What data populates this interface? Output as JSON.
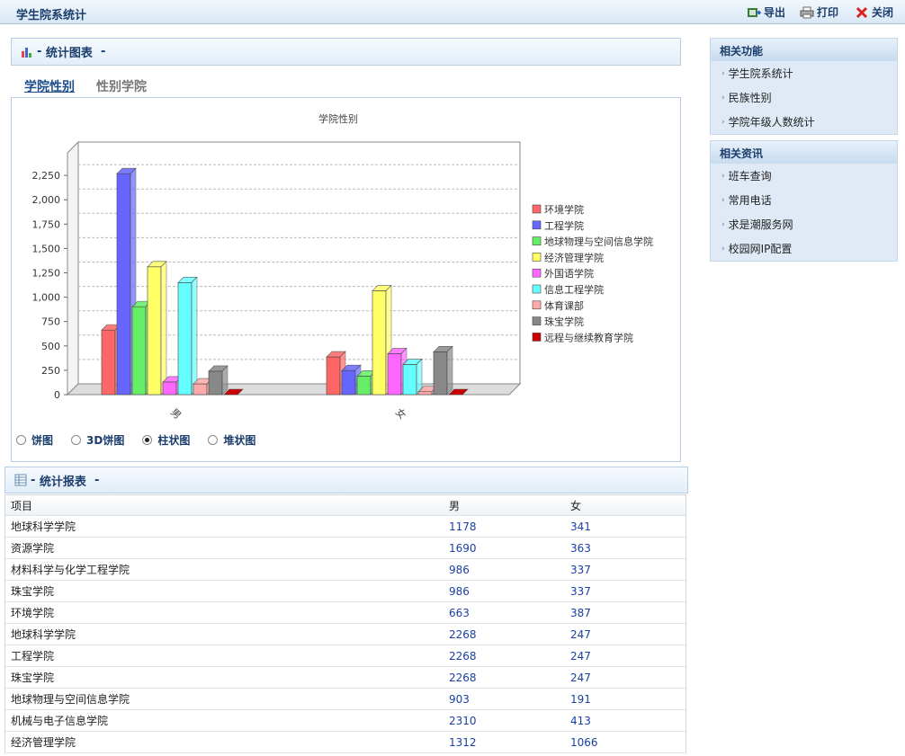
{
  "window": {
    "title": "学生院系统计",
    "export_label": "导出",
    "print_label": "打印",
    "close_label": "关闭"
  },
  "chart_section": {
    "title": "统计图表",
    "tabs": [
      "学院性别",
      "性别学院"
    ],
    "chart_types": [
      "饼图",
      "3D饼图",
      "柱状图",
      "堆状图"
    ],
    "selected_type": "柱状图"
  },
  "chart_data": {
    "type": "bar",
    "title": "学院性别",
    "categories": [
      "男",
      "女"
    ],
    "ylim": [
      0,
      2500
    ],
    "yticks": [
      "0",
      "250",
      "500",
      "750",
      "1,000",
      "1,250",
      "1,500",
      "1,750",
      "2,000",
      "2,250"
    ],
    "series": [
      {
        "name": "环境学院",
        "color": "#ff6666",
        "values": [
          663,
          387
        ]
      },
      {
        "name": "工程学院",
        "color": "#6666ff",
        "values": [
          2268,
          247
        ]
      },
      {
        "name": "地球物理与空间信息学院",
        "color": "#66ee66",
        "values": [
          903,
          191
        ]
      },
      {
        "name": "经济管理学院",
        "color": "#ffff66",
        "values": [
          1312,
          1066
        ]
      },
      {
        "name": "外国语学院",
        "color": "#ff66ff",
        "values": [
          130,
          420
        ]
      },
      {
        "name": "信息工程学院",
        "color": "#66ffff",
        "values": [
          1150,
          310
        ]
      },
      {
        "name": "体育课部",
        "color": "#ffaaaa",
        "values": [
          110,
          30
        ]
      },
      {
        "name": "珠宝学院",
        "color": "#888888",
        "values": [
          240,
          440
        ]
      },
      {
        "name": "远程与继续教育学院",
        "color": "#cc0000",
        "values": [
          0,
          0
        ]
      }
    ]
  },
  "report": {
    "title": "统计报表",
    "headers": [
      "项目",
      "男",
      "女"
    ],
    "rows": [
      [
        "地球科学学院",
        "1178",
        "341"
      ],
      [
        "资源学院",
        "1690",
        "363"
      ],
      [
        "材料科学与化学工程学院",
        "986",
        "337"
      ],
      [
        "珠宝学院",
        "986",
        "337"
      ],
      [
        "环境学院",
        "663",
        "387"
      ],
      [
        "地球科学学院",
        "2268",
        "247"
      ],
      [
        "工程学院",
        "2268",
        "247"
      ],
      [
        "珠宝学院",
        "2268",
        "247"
      ],
      [
        "地球物理与空间信息学院",
        "903",
        "191"
      ],
      [
        "机械与电子信息学院",
        "2310",
        "413"
      ],
      [
        "经济管理学院",
        "1312",
        "1066"
      ]
    ]
  },
  "sidebar": {
    "related_functions": {
      "title": "相关功能",
      "items": [
        "学生院系统计",
        "民族性别",
        "学院年级人数统计"
      ]
    },
    "related_info": {
      "title": "相关资讯",
      "items": [
        "班车查询",
        "常用电话",
        "求是潮服务网",
        "校园网IP配置"
      ]
    }
  }
}
